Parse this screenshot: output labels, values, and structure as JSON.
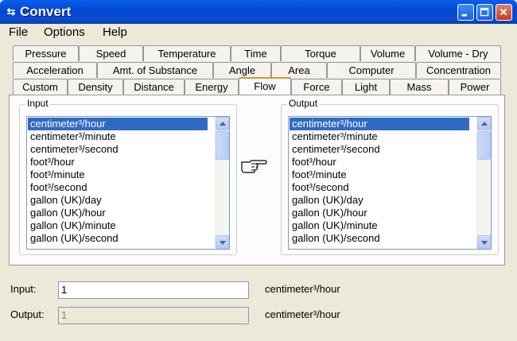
{
  "window": {
    "title": "Convert",
    "icon": "convert-arrows-icon"
  },
  "menu": [
    "File",
    "Options",
    "Help"
  ],
  "tabs": {
    "row1": [
      "Pressure",
      "Speed",
      "Temperature",
      "Time",
      "Torque",
      "Volume",
      "Volume - Dry"
    ],
    "row2": [
      "Acceleration",
      "Amt. of Substance",
      "Angle",
      "Area",
      "Computer",
      "Concentration"
    ],
    "row3": [
      "Custom",
      "Density",
      "Distance",
      "Energy",
      "Flow",
      "Force",
      "Light",
      "Mass",
      "Power"
    ],
    "active": "Flow"
  },
  "input_group": {
    "label": "Input",
    "items": [
      "centimeter³/hour",
      "centimeter³/minute",
      "centimeter³/second",
      "foot³/hour",
      "foot³/minute",
      "foot³/second",
      "gallon (UK)/day",
      "gallon (UK)/hour",
      "gallon (UK)/minute",
      "gallon (UK)/second"
    ],
    "selected": "centimeter³/hour"
  },
  "output_group": {
    "label": "Output",
    "items": [
      "centimeter³/hour",
      "centimeter³/minute",
      "centimeter³/second",
      "foot³/hour",
      "foot³/minute",
      "foot³/second",
      "gallon (UK)/day",
      "gallon (UK)/hour",
      "gallon (UK)/minute",
      "gallon (UK)/second"
    ],
    "selected": "centimeter³/hour"
  },
  "pointer_icon": "pointing-hand-icon",
  "fields": {
    "input_label": "Input:",
    "input_value": "1",
    "input_unit": "centimeter³/hour",
    "output_label": "Output:",
    "output_value": "1",
    "output_unit": "centimeter³/hour"
  },
  "colors": {
    "selection": "#316AC5",
    "titlebar": "#0246D4",
    "active_tab_accent": "#E68B2C"
  }
}
